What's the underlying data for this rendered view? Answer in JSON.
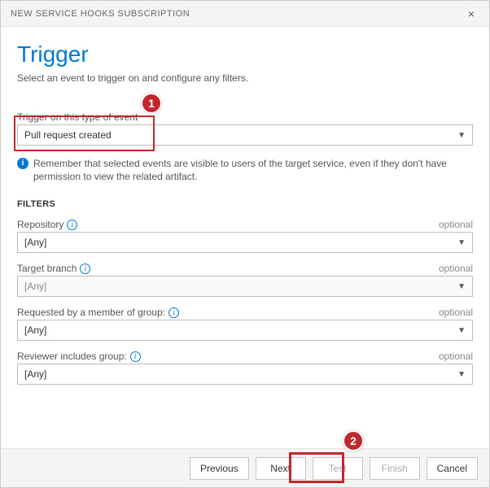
{
  "dialog": {
    "title": "NEW SERVICE HOOKS SUBSCRIPTION"
  },
  "page": {
    "heading": "Trigger",
    "subtext": "Select an event to trigger on and configure any filters."
  },
  "event": {
    "label": "Trigger on this type of event",
    "value": "Pull request created"
  },
  "info": {
    "text": "Remember that selected events are visible to users of the target service, even if they don't have permission to view the related artifact."
  },
  "filters": {
    "heading": "FILTERS",
    "optional_label": "optional",
    "repository": {
      "label": "Repository",
      "value": "[Any]"
    },
    "target_branch": {
      "label": "Target branch",
      "value": "[Any]"
    },
    "requested_by": {
      "label": "Requested by a member of group:",
      "value": "[Any]"
    },
    "reviewer": {
      "label": "Reviewer includes group:",
      "value": "[Any]"
    }
  },
  "buttons": {
    "previous": "Previous",
    "next": "Next",
    "test": "Test",
    "finish": "Finish",
    "cancel": "Cancel"
  },
  "annotations": {
    "one": "1",
    "two": "2"
  }
}
